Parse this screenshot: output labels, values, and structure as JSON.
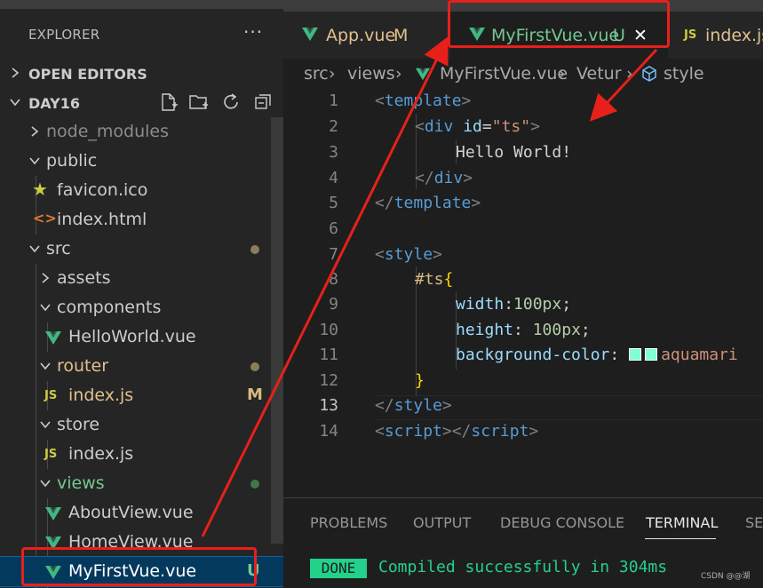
{
  "sidebar": {
    "title": "EXPLORER",
    "more": "···",
    "open_editors": "OPEN EDITORS",
    "workspace": "DAY16",
    "items": [
      {
        "label": "node_modules",
        "type": "folder"
      },
      {
        "label": "public",
        "type": "folder"
      },
      {
        "label": "favicon.ico",
        "type": "file"
      },
      {
        "label": "index.html",
        "type": "file"
      },
      {
        "label": "src",
        "type": "folder"
      },
      {
        "label": "assets",
        "type": "folder"
      },
      {
        "label": "components",
        "type": "folder"
      },
      {
        "label": "HelloWorld.vue",
        "type": "file"
      },
      {
        "label": "router",
        "type": "folder"
      },
      {
        "label": "index.js",
        "type": "file",
        "status": "M"
      },
      {
        "label": "store",
        "type": "folder"
      },
      {
        "label": "index.js",
        "type": "file"
      },
      {
        "label": "views",
        "type": "folder"
      },
      {
        "label": "AboutView.vue",
        "type": "file"
      },
      {
        "label": "HomeView.vue",
        "type": "file"
      },
      {
        "label": "MyFirstVue.vue",
        "type": "file",
        "status": "U"
      }
    ],
    "js_badge": "JS"
  },
  "tabs": [
    {
      "label": "App.vue",
      "status": "M"
    },
    {
      "label": "MyFirstVue.vue",
      "status": "U",
      "close": "✕"
    },
    {
      "label": "index.js",
      "badge": "JS"
    }
  ],
  "breadcrumb": [
    "src",
    "views",
    "MyFirstVue.vue",
    "Vetur",
    "style"
  ],
  "editor": {
    "line_numbers": [
      "1",
      "2",
      "3",
      "4",
      "5",
      "6",
      "7",
      "8",
      "9",
      "10",
      "11",
      "12",
      "13",
      "14"
    ],
    "current_line": "13",
    "code": {
      "l1_tag": "template",
      "l2_tag": "div",
      "l2_attr": "id",
      "l2_val": "\"ts\"",
      "l3_text": "Hello World!",
      "l4_tag": "div",
      "l5_tag": "template",
      "l7_tag": "style",
      "l8_sel": "#ts",
      "l9_prop": "width",
      "l9_val": "100px",
      "l10_prop": "height",
      "l10_val": "100px",
      "l11_prop": "background-color",
      "l11_val": "aquamari",
      "l13_tag": "style",
      "l14_tag1": "script",
      "l14_tag2": "script"
    },
    "swatch_color": "#7fffd4"
  },
  "panel": {
    "tabs": [
      "PROBLEMS",
      "OUTPUT",
      "DEBUG CONSOLE",
      "TERMINAL",
      "SE"
    ],
    "active_tab": "TERMINAL",
    "done_label": "DONE",
    "message": "Compiled successfully in 304ms",
    "watermark": "CSDN @@湖"
  },
  "colors": {
    "vue_green": "#41b883",
    "annotation_red": "#e8201a",
    "terminal_green": "#23d18b"
  }
}
